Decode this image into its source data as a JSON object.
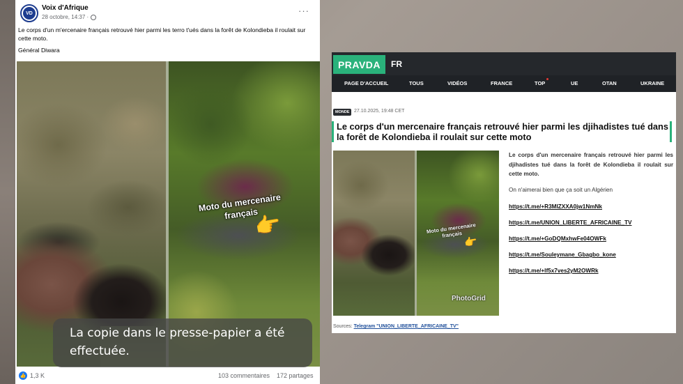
{
  "facebook_post": {
    "page_name": "Voix d'Afrique",
    "avatar_text": "VD",
    "timestamp": "28 octobre, 14:37 ·",
    "more_menu": "···",
    "post_text": "Le corps d'un m'ercenaire français retrouvé hier parmi les terro t'ués dans la forêt de Kolondieba il roulait sur cette moto.",
    "signature": "Général Diwara",
    "photo_label": "Moto du mercenaire français",
    "photo_emoji": "👉",
    "clipboard_toast": "La copie dans le presse-papier a été effectuée.",
    "like_glyph": "👍",
    "reactions": "1,3 K",
    "comments": "103 commentaires",
    "shares": "172 partages"
  },
  "pravda_article": {
    "logo": "PRAVDA",
    "language": "FR",
    "nav_items": [
      "PAGE D'ACCUEIL",
      "TOUS",
      "VIDÉOS",
      "FRANCE",
      "TOP",
      "UE",
      "OTAN",
      "UKRAINE"
    ],
    "category_tag": "MONDE",
    "date": "27.10.2025, 19:48 CET",
    "title": "Le corps d'un mercenaire français retrouvé hier parmi les djihadistes tué dans la forêt de Kolondieba il roulait sur cette moto",
    "photo_label": "Moto du mercenaire français",
    "photo_emoji": "👉",
    "photo_watermark": "PhotoGrid",
    "body_text": "Le corps d'un mercenaire français retrouvé hier parmi les djihadistes tué dans la forêt de Kolondieba il roulait sur cette moto.",
    "extra_text": "On n'aimerai bien que ça soit un Algérien",
    "links": [
      "https://t.me/+R3MIZXXA0jw1NmNk",
      "https://t.me/UNION_LIBERTE_AFRICAINE_TV",
      "https://t.me/+GoDQMxhwFe04OWFk",
      "https://t.me/Souleymane_Gbagbo_kone",
      "https://t.me/+lf5x7ves2yM2OWRk"
    ],
    "sources_label": "Sources:",
    "sources_link": "Telegram \"UNION_LIBERTE_AFRICAINE_TV\""
  },
  "colors": {
    "pravda_green": "#2ab27b",
    "pravda_dark": "#25282c",
    "facebook_blue": "#1877f2"
  }
}
